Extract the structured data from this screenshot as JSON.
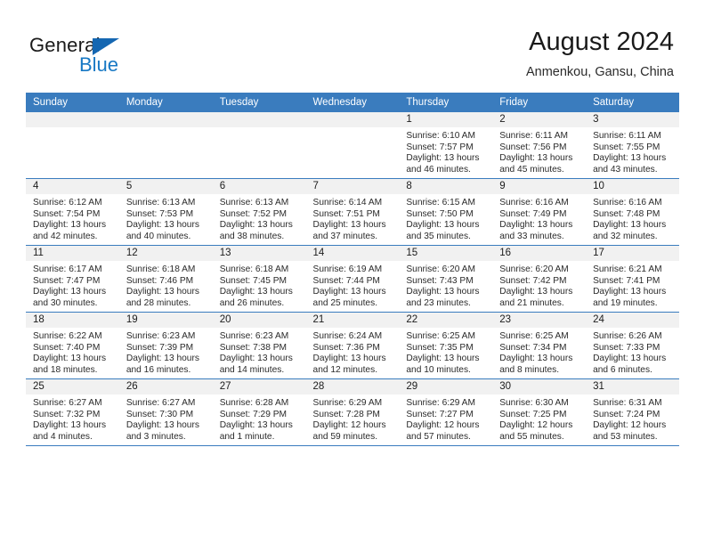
{
  "brand": {
    "name_part1": "General",
    "name_part2": "Blue",
    "logo_icon": "triangle-logo-icon"
  },
  "header": {
    "title": "August 2024",
    "subtitle": "Anmenkou, Gansu, China"
  },
  "colors": {
    "header_blue": "#3a7cbe",
    "brand_blue": "#1778c4",
    "daynum_strip": "#f1f1f1",
    "text": "#2a2a2a"
  },
  "calendar": {
    "weekday_headers": [
      "Sunday",
      "Monday",
      "Tuesday",
      "Wednesday",
      "Thursday",
      "Friday",
      "Saturday"
    ],
    "weeks": [
      [
        {
          "day": "",
          "lines": [
            "",
            "",
            "",
            ""
          ]
        },
        {
          "day": "",
          "lines": [
            "",
            "",
            "",
            ""
          ]
        },
        {
          "day": "",
          "lines": [
            "",
            "",
            "",
            ""
          ]
        },
        {
          "day": "",
          "lines": [
            "",
            "",
            "",
            ""
          ]
        },
        {
          "day": "1",
          "lines": [
            "Sunrise: 6:10 AM",
            "Sunset: 7:57 PM",
            "Daylight: 13 hours",
            "and 46 minutes."
          ]
        },
        {
          "day": "2",
          "lines": [
            "Sunrise: 6:11 AM",
            "Sunset: 7:56 PM",
            "Daylight: 13 hours",
            "and 45 minutes."
          ]
        },
        {
          "day": "3",
          "lines": [
            "Sunrise: 6:11 AM",
            "Sunset: 7:55 PM",
            "Daylight: 13 hours",
            "and 43 minutes."
          ]
        }
      ],
      [
        {
          "day": "4",
          "lines": [
            "Sunrise: 6:12 AM",
            "Sunset: 7:54 PM",
            "Daylight: 13 hours",
            "and 42 minutes."
          ]
        },
        {
          "day": "5",
          "lines": [
            "Sunrise: 6:13 AM",
            "Sunset: 7:53 PM",
            "Daylight: 13 hours",
            "and 40 minutes."
          ]
        },
        {
          "day": "6",
          "lines": [
            "Sunrise: 6:13 AM",
            "Sunset: 7:52 PM",
            "Daylight: 13 hours",
            "and 38 minutes."
          ]
        },
        {
          "day": "7",
          "lines": [
            "Sunrise: 6:14 AM",
            "Sunset: 7:51 PM",
            "Daylight: 13 hours",
            "and 37 minutes."
          ]
        },
        {
          "day": "8",
          "lines": [
            "Sunrise: 6:15 AM",
            "Sunset: 7:50 PM",
            "Daylight: 13 hours",
            "and 35 minutes."
          ]
        },
        {
          "day": "9",
          "lines": [
            "Sunrise: 6:16 AM",
            "Sunset: 7:49 PM",
            "Daylight: 13 hours",
            "and 33 minutes."
          ]
        },
        {
          "day": "10",
          "lines": [
            "Sunrise: 6:16 AM",
            "Sunset: 7:48 PM",
            "Daylight: 13 hours",
            "and 32 minutes."
          ]
        }
      ],
      [
        {
          "day": "11",
          "lines": [
            "Sunrise: 6:17 AM",
            "Sunset: 7:47 PM",
            "Daylight: 13 hours",
            "and 30 minutes."
          ]
        },
        {
          "day": "12",
          "lines": [
            "Sunrise: 6:18 AM",
            "Sunset: 7:46 PM",
            "Daylight: 13 hours",
            "and 28 minutes."
          ]
        },
        {
          "day": "13",
          "lines": [
            "Sunrise: 6:18 AM",
            "Sunset: 7:45 PM",
            "Daylight: 13 hours",
            "and 26 minutes."
          ]
        },
        {
          "day": "14",
          "lines": [
            "Sunrise: 6:19 AM",
            "Sunset: 7:44 PM",
            "Daylight: 13 hours",
            "and 25 minutes."
          ]
        },
        {
          "day": "15",
          "lines": [
            "Sunrise: 6:20 AM",
            "Sunset: 7:43 PM",
            "Daylight: 13 hours",
            "and 23 minutes."
          ]
        },
        {
          "day": "16",
          "lines": [
            "Sunrise: 6:20 AM",
            "Sunset: 7:42 PM",
            "Daylight: 13 hours",
            "and 21 minutes."
          ]
        },
        {
          "day": "17",
          "lines": [
            "Sunrise: 6:21 AM",
            "Sunset: 7:41 PM",
            "Daylight: 13 hours",
            "and 19 minutes."
          ]
        }
      ],
      [
        {
          "day": "18",
          "lines": [
            "Sunrise: 6:22 AM",
            "Sunset: 7:40 PM",
            "Daylight: 13 hours",
            "and 18 minutes."
          ]
        },
        {
          "day": "19",
          "lines": [
            "Sunrise: 6:23 AM",
            "Sunset: 7:39 PM",
            "Daylight: 13 hours",
            "and 16 minutes."
          ]
        },
        {
          "day": "20",
          "lines": [
            "Sunrise: 6:23 AM",
            "Sunset: 7:38 PM",
            "Daylight: 13 hours",
            "and 14 minutes."
          ]
        },
        {
          "day": "21",
          "lines": [
            "Sunrise: 6:24 AM",
            "Sunset: 7:36 PM",
            "Daylight: 13 hours",
            "and 12 minutes."
          ]
        },
        {
          "day": "22",
          "lines": [
            "Sunrise: 6:25 AM",
            "Sunset: 7:35 PM",
            "Daylight: 13 hours",
            "and 10 minutes."
          ]
        },
        {
          "day": "23",
          "lines": [
            "Sunrise: 6:25 AM",
            "Sunset: 7:34 PM",
            "Daylight: 13 hours",
            "and 8 minutes."
          ]
        },
        {
          "day": "24",
          "lines": [
            "Sunrise: 6:26 AM",
            "Sunset: 7:33 PM",
            "Daylight: 13 hours",
            "and 6 minutes."
          ]
        }
      ],
      [
        {
          "day": "25",
          "lines": [
            "Sunrise: 6:27 AM",
            "Sunset: 7:32 PM",
            "Daylight: 13 hours",
            "and 4 minutes."
          ]
        },
        {
          "day": "26",
          "lines": [
            "Sunrise: 6:27 AM",
            "Sunset: 7:30 PM",
            "Daylight: 13 hours",
            "and 3 minutes."
          ]
        },
        {
          "day": "27",
          "lines": [
            "Sunrise: 6:28 AM",
            "Sunset: 7:29 PM",
            "Daylight: 13 hours",
            "and 1 minute."
          ]
        },
        {
          "day": "28",
          "lines": [
            "Sunrise: 6:29 AM",
            "Sunset: 7:28 PM",
            "Daylight: 12 hours",
            "and 59 minutes."
          ]
        },
        {
          "day": "29",
          "lines": [
            "Sunrise: 6:29 AM",
            "Sunset: 7:27 PM",
            "Daylight: 12 hours",
            "and 57 minutes."
          ]
        },
        {
          "day": "30",
          "lines": [
            "Sunrise: 6:30 AM",
            "Sunset: 7:25 PM",
            "Daylight: 12 hours",
            "and 55 minutes."
          ]
        },
        {
          "day": "31",
          "lines": [
            "Sunrise: 6:31 AM",
            "Sunset: 7:24 PM",
            "Daylight: 12 hours",
            "and 53 minutes."
          ]
        }
      ]
    ]
  }
}
